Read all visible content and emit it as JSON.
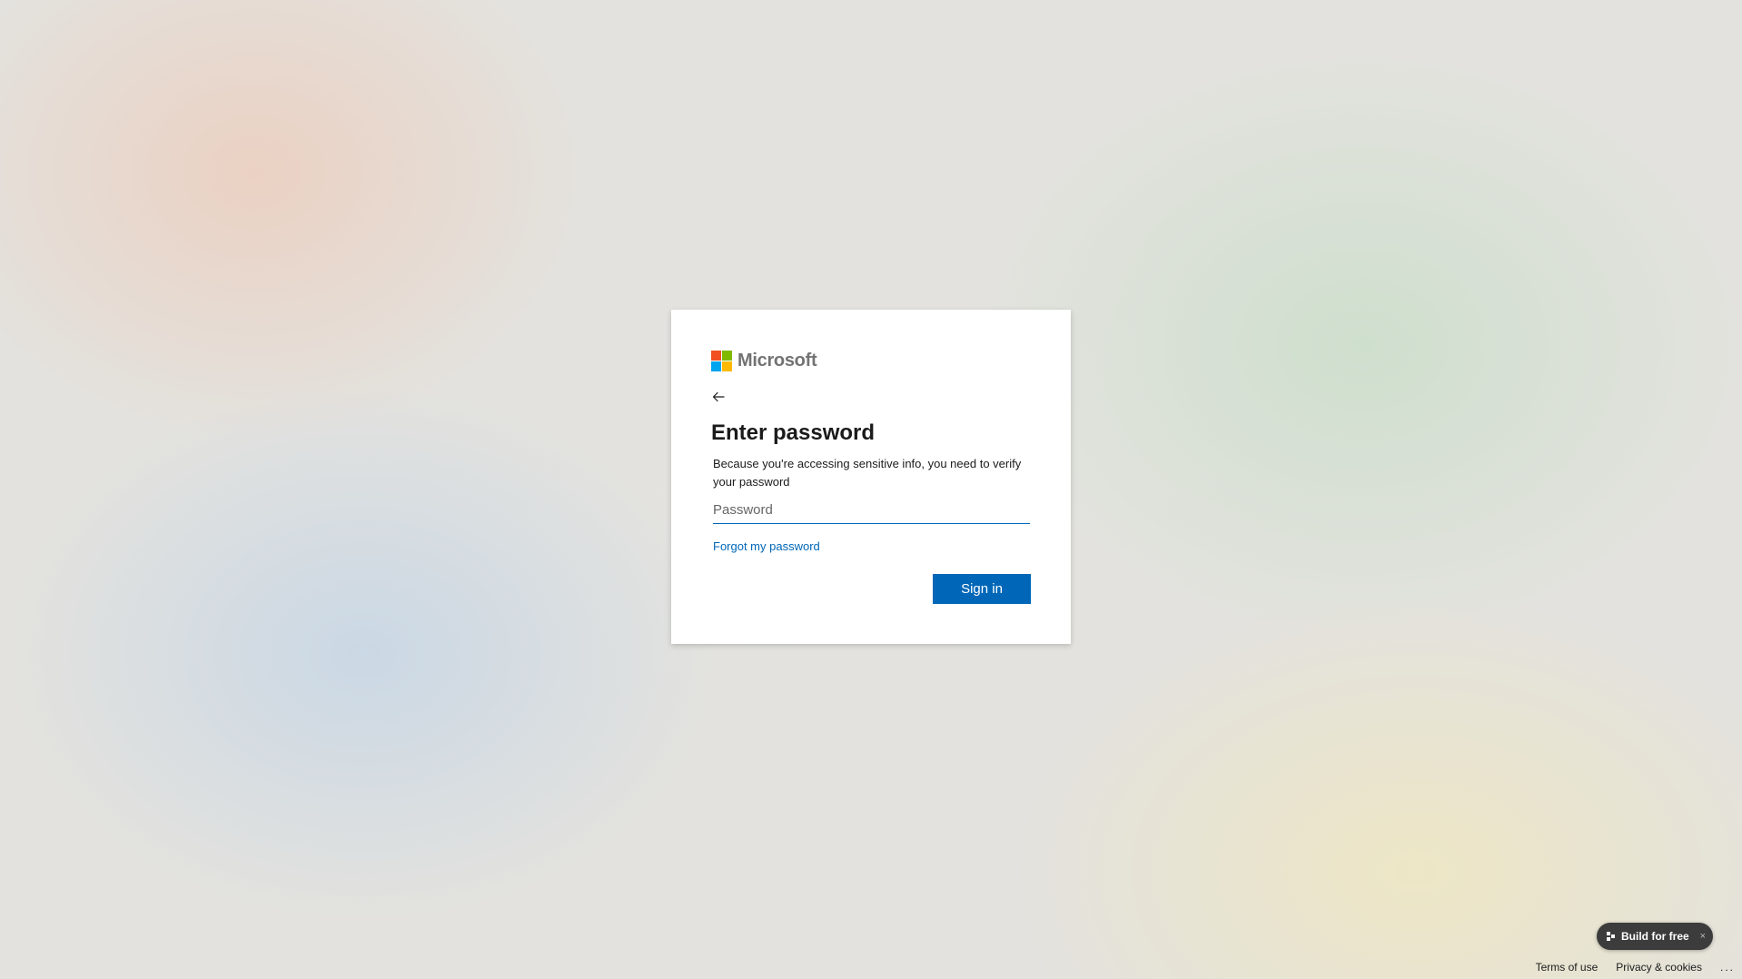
{
  "brand": {
    "name": "Microsoft",
    "logo_colors": [
      "#f25022",
      "#7fba00",
      "#00a4ef",
      "#ffb900"
    ]
  },
  "card": {
    "back_icon": "arrow-left-icon",
    "title": "Enter password",
    "description": "Because you're accessing sensitive info, you need to verify your password",
    "password_placeholder": "Password",
    "password_value": "",
    "forgot_link": "Forgot my password",
    "signin_label": "Sign in"
  },
  "promo": {
    "icon": "build-icon",
    "label": "Build for free",
    "close": "×"
  },
  "footer": {
    "terms": "Terms of use",
    "privacy": "Privacy & cookies",
    "more": "..."
  },
  "colors": {
    "accent": "#0067b8",
    "text": "#1b1b1b"
  }
}
